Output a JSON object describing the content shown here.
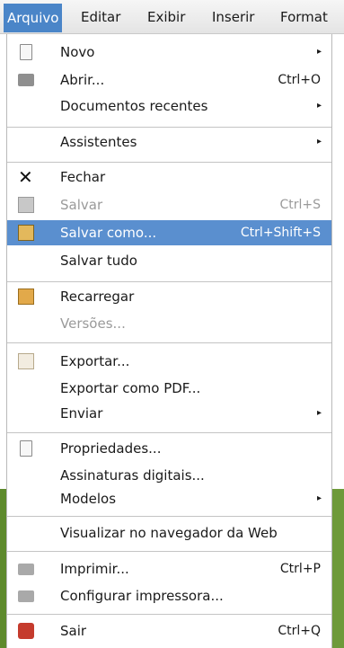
{
  "menubar": {
    "items": [
      "Arquivo",
      "Editar",
      "Exibir",
      "Inserir",
      "Format"
    ]
  },
  "menu": {
    "items": [
      {
        "label": "Novo",
        "shortcut": ""
      },
      {
        "label": "Abrir...",
        "shortcut": "Ctrl+O"
      },
      {
        "label": "Documentos recentes",
        "shortcut": ""
      },
      {
        "label": "Assistentes",
        "shortcut": ""
      },
      {
        "label": "Fechar",
        "shortcut": ""
      },
      {
        "label": "Salvar",
        "shortcut": "Ctrl+S"
      },
      {
        "label": "Salvar como...",
        "shortcut": "Ctrl+Shift+S"
      },
      {
        "label": "Salvar tudo",
        "shortcut": ""
      },
      {
        "label": "Recarregar",
        "shortcut": ""
      },
      {
        "label": "Versões...",
        "shortcut": ""
      },
      {
        "label": "Exportar...",
        "shortcut": ""
      },
      {
        "label": "Exportar como PDF...",
        "shortcut": ""
      },
      {
        "label": "Enviar",
        "shortcut": ""
      },
      {
        "label": "Propriedades...",
        "shortcut": ""
      },
      {
        "label": "Assinaturas digitais...",
        "shortcut": ""
      },
      {
        "label": "Modelos",
        "shortcut": ""
      },
      {
        "label": "Visualizar no navegador da Web",
        "shortcut": ""
      },
      {
        "label": "Imprimir...",
        "shortcut": "Ctrl+P"
      },
      {
        "label": "Configurar impressora...",
        "shortcut": ""
      },
      {
        "label": "Sair",
        "shortcut": "Ctrl+Q"
      }
    ]
  },
  "colors": {
    "highlight": "#5a8fcf",
    "active_menu": "#4a85c8",
    "background_green": "#6e9a3a"
  }
}
